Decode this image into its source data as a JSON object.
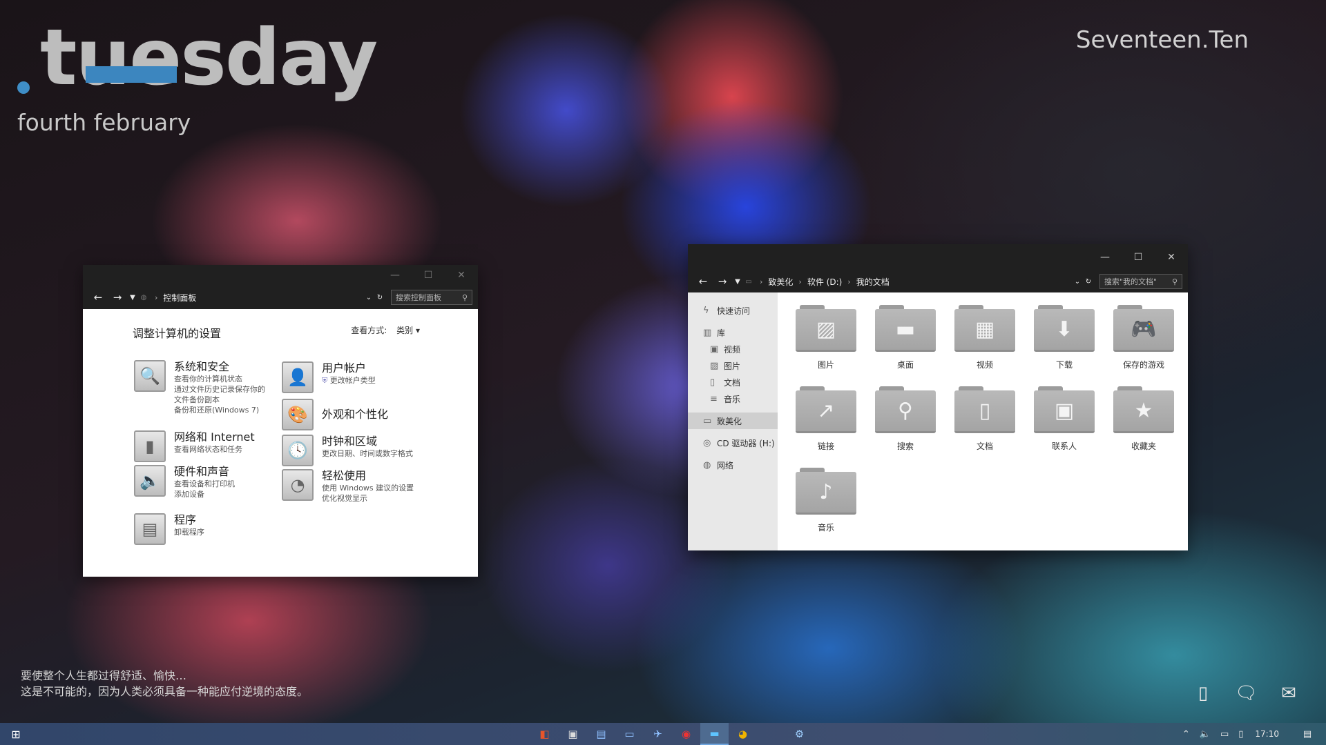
{
  "desktop": {
    "day": "tuesday",
    "date": "fourth february",
    "brand": "Seventeen.Ten",
    "quote_line1": "要使整个人生都过得舒适、愉快…",
    "quote_line2": "这是不可能的，因为人类必须具备一种能应付逆境的态度。",
    "accent_color": "#3f8ec7",
    "icons": [
      "phone-icon",
      "chat-bubble-icon",
      "mail-icon"
    ]
  },
  "control_panel": {
    "address": "控制面板",
    "search_placeholder": "搜索控制面板",
    "heading": "调整计算机的设置",
    "view_label": "查看方式:",
    "view_value": "类别",
    "categories": [
      {
        "title": "系统和安全",
        "subs": [
          "查看你的计算机状态",
          "通过文件历史记录保存你的",
          "文件备份副本",
          "备份和还原(Windows 7)"
        ]
      },
      {
        "title": "网络和 Internet",
        "subs": [
          "查看网络状态和任务"
        ]
      },
      {
        "title": "硬件和声音",
        "subs": [
          "查看设备和打印机",
          "添加设备"
        ]
      },
      {
        "title": "程序",
        "subs": [
          "卸载程序"
        ]
      },
      {
        "title": "用户帐户",
        "subs": [
          "更改帐户类型"
        ]
      },
      {
        "title": "外观和个性化",
        "subs": []
      },
      {
        "title": "时钟和区域",
        "subs": [
          "更改日期、时间或数字格式"
        ]
      },
      {
        "title": "轻松使用",
        "subs": [
          "使用 Windows 建议的设置",
          "优化视觉显示"
        ]
      }
    ]
  },
  "explorer": {
    "crumbs": [
      "致美化",
      "软件 (D:)",
      "我的文档"
    ],
    "search_placeholder": "搜索\"我的文档\"",
    "sidebar": {
      "quick_access": "快速访问",
      "library": "库",
      "videos": "视频",
      "pictures": "图片",
      "documents": "文档",
      "music": "音乐",
      "this_pc": "致美化",
      "cd_drive": "CD 驱动器 (H:)",
      "network": "网络"
    },
    "folders": [
      "图片",
      "桌面",
      "视频",
      "下载",
      "保存的游戏",
      "链接",
      "搜索",
      "文档",
      "联系人",
      "收藏夹",
      "音乐"
    ]
  },
  "taskbar": {
    "clock": "17:10",
    "apps": [
      "office-icon",
      "window-icon",
      "notepad-icon",
      "terminal-icon",
      "bird-icon",
      "netease-icon",
      "explorer-icon",
      "chrome-icon",
      "settings-icon"
    ]
  }
}
